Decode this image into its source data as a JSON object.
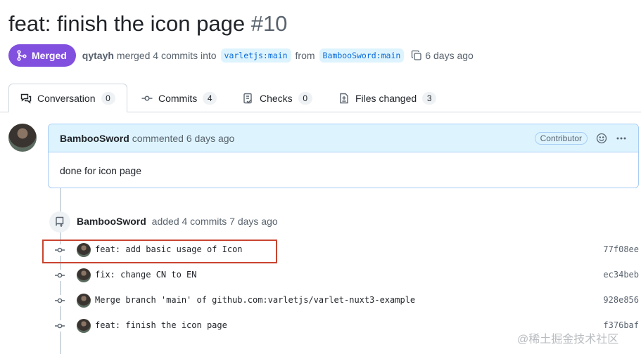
{
  "pr": {
    "title": "feat: finish the icon page",
    "number": "#10",
    "state": "Merged",
    "merged_by": "qytayh",
    "merge_text": "merged 4 commits into",
    "base_branch": "varletjs:main",
    "from_text": "from",
    "head_branch": "BambooSword:main",
    "time": "6 days ago"
  },
  "tabs": [
    {
      "label": "Conversation",
      "count": "0"
    },
    {
      "label": "Commits",
      "count": "4"
    },
    {
      "label": "Checks",
      "count": "0"
    },
    {
      "label": "Files changed",
      "count": "3"
    }
  ],
  "comment": {
    "author": "BambooSword",
    "action": "commented 6 days ago",
    "role": "Contributor",
    "body": "done for icon page"
  },
  "push": {
    "author": "BambooSword",
    "action": "added 4 commits 7 days ago"
  },
  "commits": [
    {
      "message": "feat: add basic usage of Icon",
      "sha": "77f08ee"
    },
    {
      "message": "fix: change CN to EN",
      "sha": "ec34beb"
    },
    {
      "message": "Merge branch 'main' of github.com:varletjs/varlet-nuxt3-example",
      "sha": "928e856"
    },
    {
      "message": "feat: finish the icon page",
      "sha": "f376baf"
    }
  ],
  "watermark": "@稀土掘金技术社区",
  "colors": {
    "merged": "#8250df",
    "link": "#0969da",
    "highlight": "#c9442f"
  }
}
